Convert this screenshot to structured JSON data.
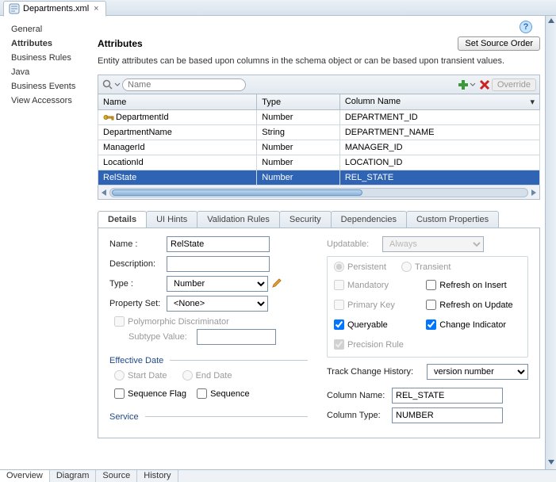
{
  "file_tab": {
    "name": "Departments.xml"
  },
  "sidebar": {
    "items": [
      {
        "label": "General"
      },
      {
        "label": "Attributes"
      },
      {
        "label": "Business Rules"
      },
      {
        "label": "Java"
      },
      {
        "label": "Business Events"
      },
      {
        "label": "View Accessors"
      }
    ],
    "active_index": 1
  },
  "header": {
    "title": "Attributes",
    "set_source_order": "Set Source Order",
    "description": "Entity attributes can be based upon columns in the schema object or can be based upon transient values."
  },
  "search": {
    "placeholder": "Name"
  },
  "toolbar": {
    "override": "Override"
  },
  "table": {
    "columns": [
      "Name",
      "Type",
      "Column Name"
    ],
    "rows": [
      {
        "name": "DepartmentId",
        "type": "Number",
        "col": "DEPARTMENT_ID",
        "key": true
      },
      {
        "name": "DepartmentName",
        "type": "String",
        "col": "DEPARTMENT_NAME"
      },
      {
        "name": "ManagerId",
        "type": "Number",
        "col": "MANAGER_ID"
      },
      {
        "name": "LocationId",
        "type": "Number",
        "col": "LOCATION_ID"
      },
      {
        "name": "RelState",
        "type": "Number",
        "col": "REL_STATE",
        "selected": true
      }
    ]
  },
  "tabs": {
    "items": [
      "Details",
      "UI Hints",
      "Validation Rules",
      "Security",
      "Dependencies",
      "Custom Properties"
    ],
    "active_index": 0
  },
  "details": {
    "labels": {
      "name": "Name :",
      "description": "Description:",
      "type": "Type :",
      "property_set": "Property Set:",
      "poly": "Polymorphic Discriminator",
      "subtype": "Subtype Value:",
      "effective_date": "Effective Date",
      "start_date": "Start Date",
      "end_date": "End Date",
      "sequence_flag": "Sequence Flag",
      "sequence": "Sequence",
      "service": "Service",
      "updatable": "Updatable:",
      "persistent": "Persistent",
      "transient": "Transient",
      "mandatory": "Mandatory",
      "refresh_insert": "Refresh on Insert",
      "primary_key": "Primary Key",
      "refresh_update": "Refresh on Update",
      "queryable": "Queryable",
      "change_indicator": "Change Indicator",
      "precision_rule": "Precision Rule",
      "track_history": "Track Change History:",
      "column_name": "Column Name:",
      "column_type": "Column Type:"
    },
    "values": {
      "name": "RelState",
      "description": "",
      "type": "Number",
      "property_set": "<None>",
      "subtype": "",
      "updatable": "Always",
      "track_history": "version number",
      "column_name": "REL_STATE",
      "column_type": "NUMBER"
    },
    "checks": {
      "poly": false,
      "sequence_flag": false,
      "sequence": false,
      "start_date": false,
      "end_date": false,
      "persistent": true,
      "transient": false,
      "mandatory": false,
      "refresh_insert": false,
      "primary_key": false,
      "refresh_update": false,
      "queryable": true,
      "change_indicator": true,
      "precision_rule": true
    }
  },
  "footer": {
    "tabs": [
      "Overview",
      "Diagram",
      "Source",
      "History"
    ],
    "active_index": 0
  }
}
